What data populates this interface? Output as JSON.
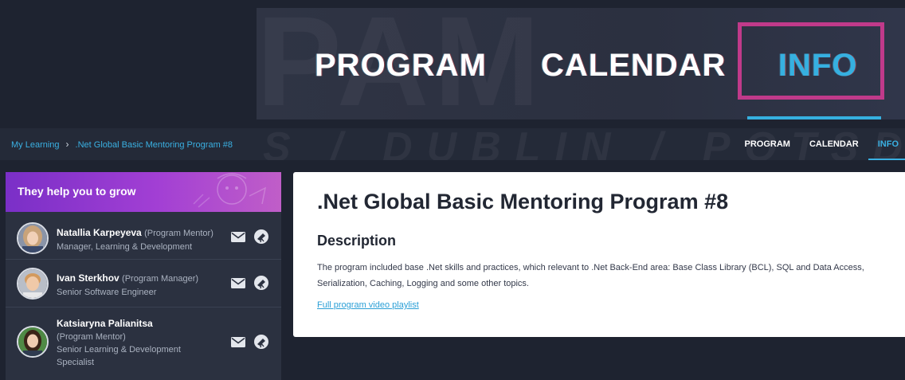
{
  "banner": {
    "bg_text": "PAM",
    "tabs": [
      "PROGRAM",
      "CALENDAR",
      "INFO"
    ],
    "active_tab": "INFO"
  },
  "navbar": {
    "bg_text": "S / DUBLIN / POTSDAM",
    "breadcrumb": [
      "My Learning",
      ".Net Global Basic Mentoring Program #8"
    ],
    "tabs": [
      "PROGRAM",
      "CALENDAR",
      "INFO"
    ],
    "active_tab": "INFO"
  },
  "mentors": {
    "header": "They help you to grow",
    "people": [
      {
        "name": "Natallia Karpeyeva",
        "role": "(Program Mentor)",
        "title": "Manager, Learning & Development"
      },
      {
        "name": "Ivan Sterkhov",
        "role": "(Program Manager)",
        "title": "Senior Software Engineer"
      },
      {
        "name": "Katsiaryna Palianitsa",
        "role": "(Program Mentor)",
        "title": "Senior Learning & Development Specialist"
      }
    ]
  },
  "program": {
    "title": ".Net Global Basic Mentoring Program #8",
    "section": "Description",
    "description": "The program included base .Net skills and practices, which relevant to .Net Back-End area: Base Class Library (BCL), SQL and Data Access, Serialization, Caching, Logging and some other topics.",
    "link": "Full program video playlist"
  },
  "colors": {
    "accent": "#36b0e0",
    "highlight": "#c03a8a",
    "header_gradient": "#7a2fc7"
  }
}
